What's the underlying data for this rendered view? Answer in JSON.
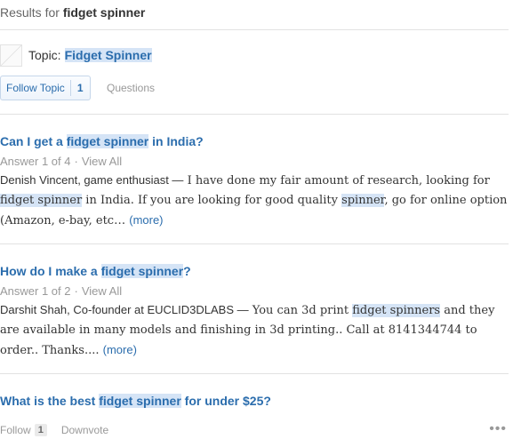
{
  "header": {
    "prefix": "Results for",
    "query": "fidget spinner"
  },
  "topic": {
    "label": "Topic:",
    "name": "Fidget Spinner"
  },
  "follow": {
    "label": "Follow Topic",
    "count": "1",
    "questions_tab": "Questions"
  },
  "results": [
    {
      "title_pre": "Can I get a ",
      "title_hl": "fidget spinner",
      "title_post": " in India?",
      "answer_meta": "Answer 1 of 4",
      "view_all": "View All",
      "author": "Denish Vincent, game enthusiast —",
      "text_1": " I have done my fair amount of research, looking for ",
      "hl_1": "fidget spinner",
      "text_2": " in India. If you are looking for good quality ",
      "hl_2": "spinner",
      "text_3": ", go for online option (Amazon, e-bay, etc… ",
      "more": "(more)"
    },
    {
      "title_pre": "How do I make a ",
      "title_hl": "fidget spinner",
      "title_post": "?",
      "answer_meta": "Answer 1 of 2",
      "view_all": "View All",
      "author": "Darshit Shah, Co-founder at EUCLID3DLABS —",
      "text_1": " You can 3d print ",
      "hl_1": "fidget spinners",
      "text_2": " and they are available in many models and finishing in 3d printing.. Call at 8141344744 to order.. Thanks.... ",
      "more": "(more)"
    },
    {
      "title_pre": "What is the best ",
      "title_hl": "fidget spinner",
      "title_post": " for under $25?"
    }
  ],
  "bottom": {
    "follow": "Follow",
    "follow_count": "1",
    "downvote": "Downvote",
    "more_menu": "•••"
  }
}
